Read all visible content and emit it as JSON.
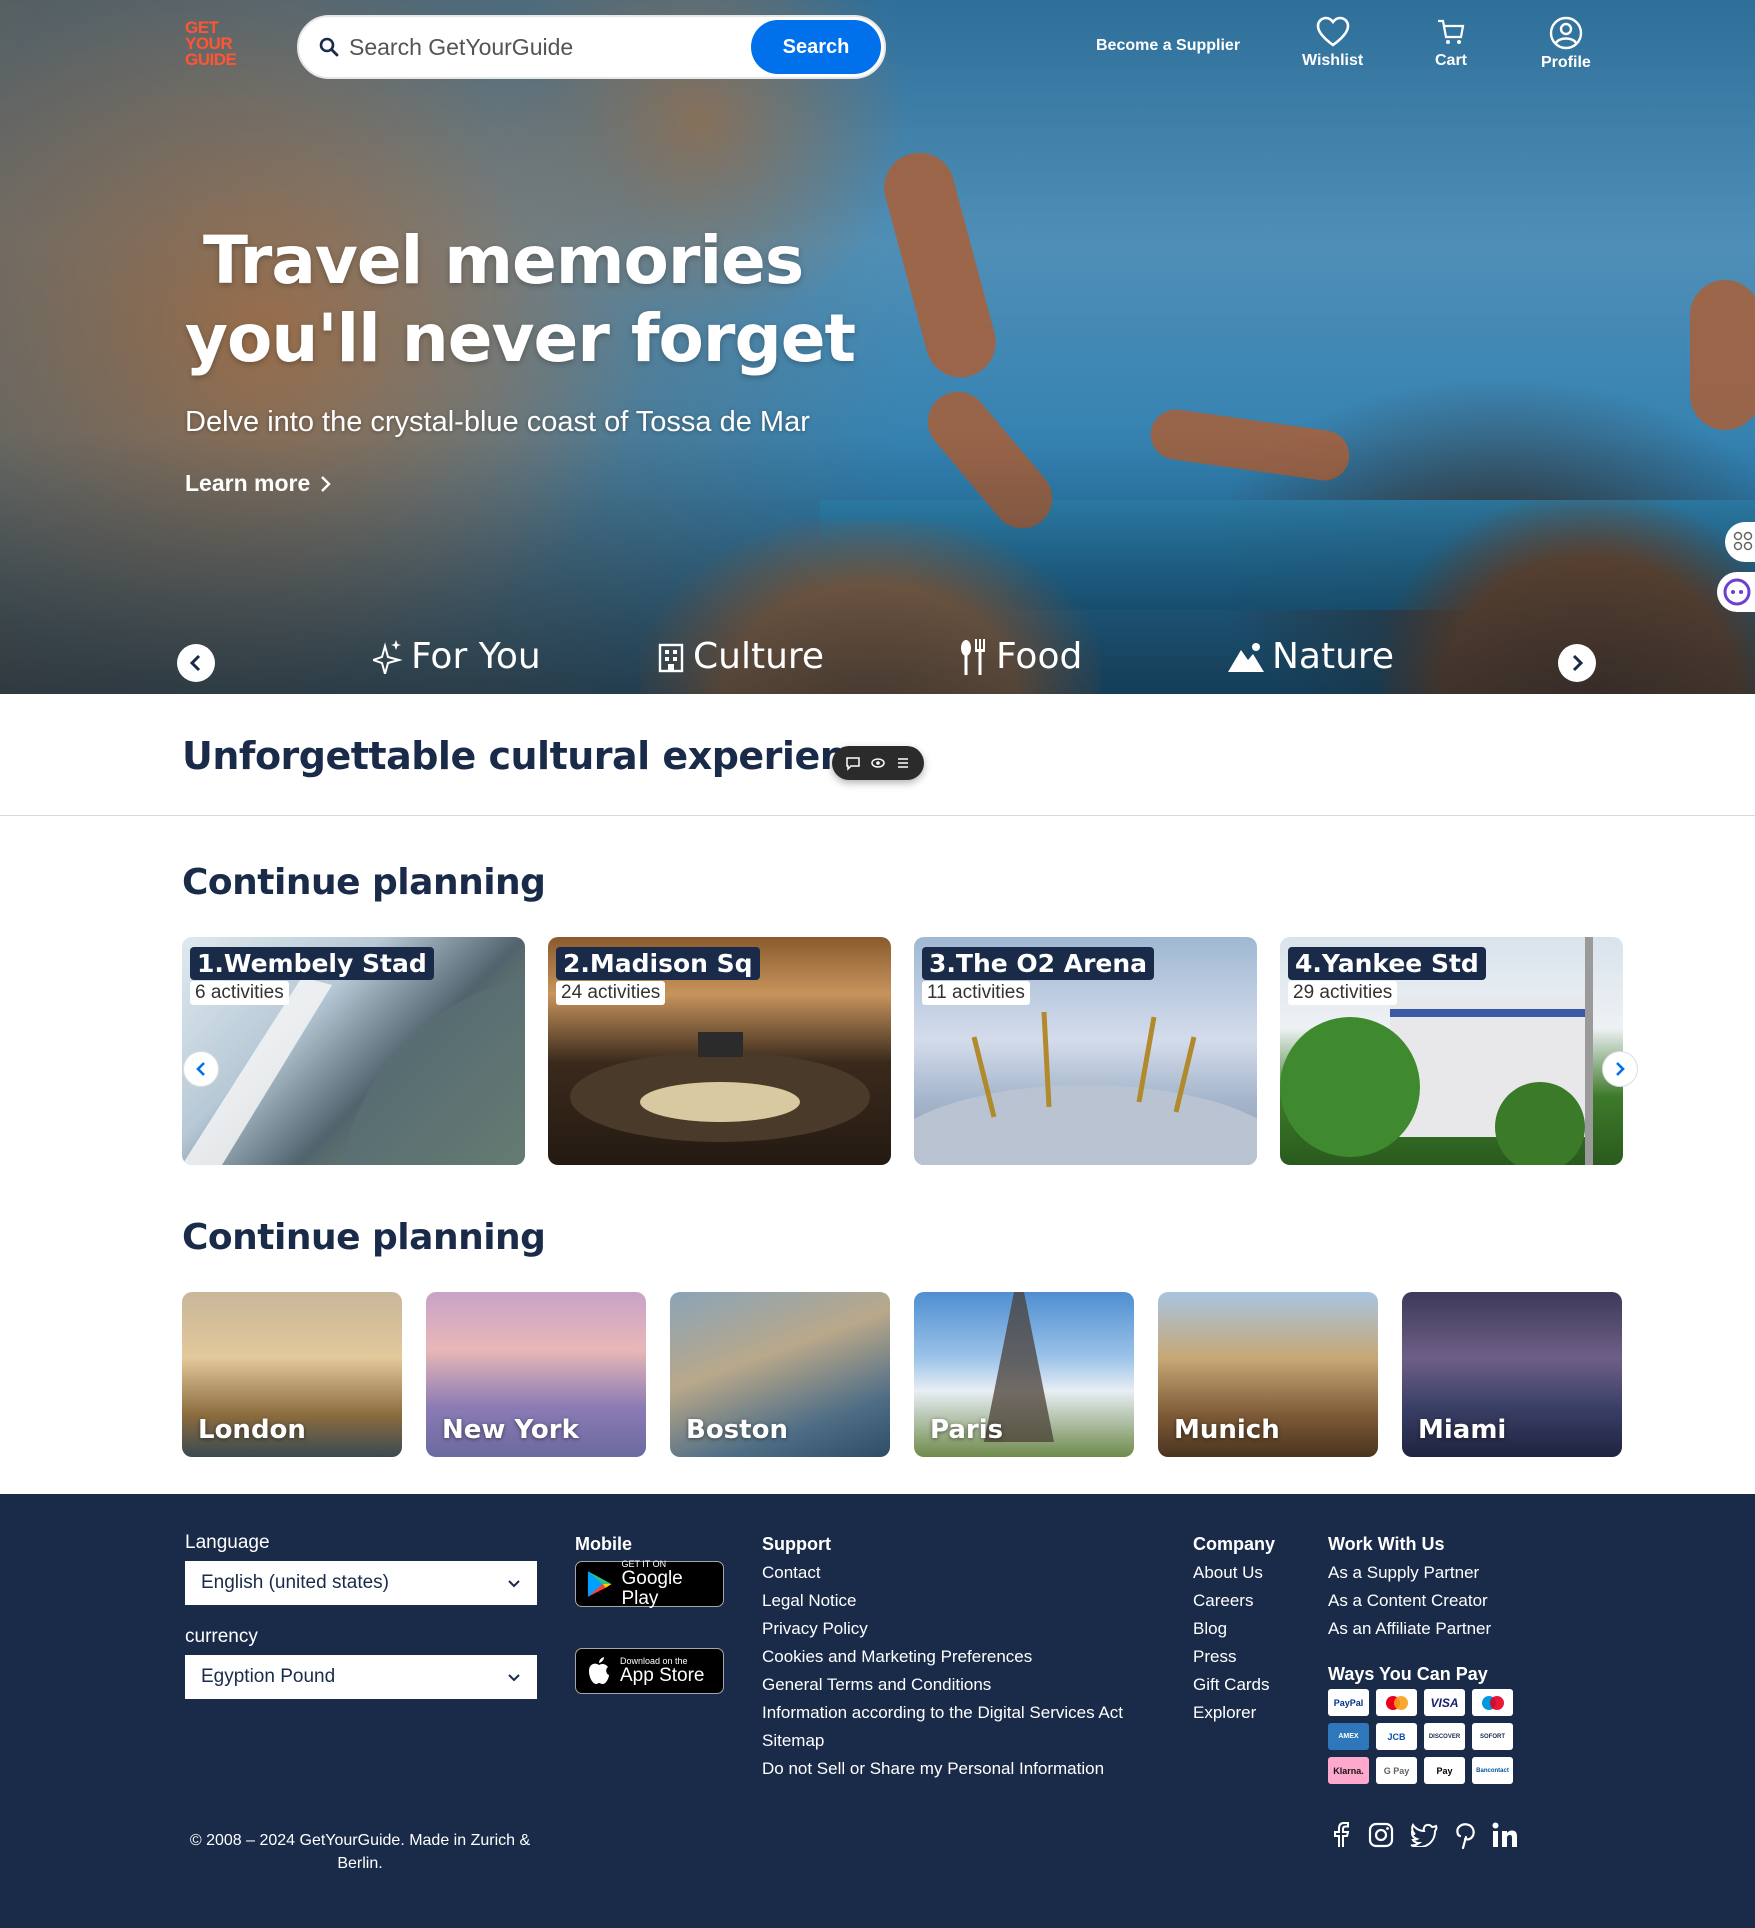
{
  "brand": {
    "logo_lines": [
      "GET",
      "YOUR",
      "GUIDE"
    ],
    "accent": "#ff5533",
    "primary": "#0071eb",
    "navy": "#1a2b49"
  },
  "header": {
    "search_placeholder": "Search GetYourGuide",
    "search_button": "Search",
    "become_supplier": "Become a Supplier",
    "nav": [
      {
        "label": "Wishlist",
        "icon": "heart-icon"
      },
      {
        "label": "Cart",
        "icon": "cart-icon"
      },
      {
        "label": "Profile",
        "icon": "profile-icon"
      }
    ]
  },
  "hero": {
    "title_line1": "Travel memories",
    "title_line2": "you'll never forget",
    "subtitle": "Delve into the crystal-blue coast of Tossa de Mar",
    "learn_more": "Learn more",
    "categories": [
      {
        "label": "For You",
        "icon": "sparkle-icon"
      },
      {
        "label": "Culture",
        "icon": "building-icon"
      },
      {
        "label": "Food",
        "icon": "fork-knife-icon"
      },
      {
        "label": "Nature",
        "icon": "mountain-icon"
      }
    ]
  },
  "sections": {
    "cultural_heading": "Unforgettable cultural experiences",
    "continue_planning_1": "Continue planning",
    "continue_planning_2": "Continue planning"
  },
  "venues": [
    {
      "title": "1.Wembely Stad",
      "count": "6 activities"
    },
    {
      "title": "2.Madison Sq",
      "count": "24 activities"
    },
    {
      "title": "3.The O2 Arena",
      "count": "11 activities"
    },
    {
      "title": "4.Yankee Std",
      "count": "29 activities"
    }
  ],
  "cities": [
    "London",
    "New York",
    "Boston",
    "Paris",
    "Munich",
    "Miami"
  ],
  "footer": {
    "language_label": "Language",
    "language_value": "English (united states)",
    "currency_label": "currency",
    "currency_value": "Egyption Pound",
    "mobile_heading": "Mobile",
    "google_play_small": "GET IT ON",
    "google_play_big": "Google Play",
    "app_store_small": "Download on the",
    "app_store_big": "App Store",
    "support_heading": "Support",
    "support_links": [
      "Contact",
      "Legal Notice",
      "Privacy Policy",
      "Cookies and Marketing Preferences",
      "General Terms and Conditions",
      "Information according to the Digital Services Act",
      "Sitemap",
      "Do not Sell or Share my Personal Information"
    ],
    "company_heading": "Company",
    "company_links": [
      "About Us",
      "Careers",
      "Blog",
      "Press",
      "Gift Cards",
      "Explorer"
    ],
    "work_heading": "Work With Us",
    "work_links": [
      "As a Supply Partner",
      "As a Content Creator",
      "As an Affiliate Partner"
    ],
    "pay_heading": "Ways You Can Pay",
    "payment_methods": [
      "PayPal",
      "Mastercard",
      "VISA",
      "Maestro",
      "AMEX",
      "JCB",
      "DISCOVER",
      "SOFORT",
      "Klarna.",
      "G Pay",
      "Pay",
      "Bancontact"
    ],
    "socials": [
      "facebook-icon",
      "instagram-icon",
      "twitter-icon",
      "pinterest-icon",
      "linkedin-icon"
    ],
    "copyright": "© 2008 – 2024 GetYourGuide. Made in Zurich & Berlin."
  }
}
